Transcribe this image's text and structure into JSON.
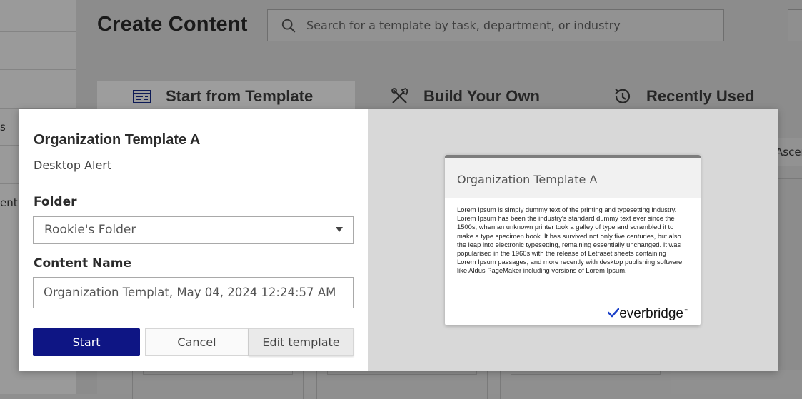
{
  "background": {
    "page_title": "Create Content",
    "search": {
      "placeholder": "Search for a template by task, department, or industry"
    },
    "tabs": [
      {
        "label": "Start from Template",
        "icon": "template-icon",
        "active": true
      },
      {
        "label": "Build Your Own",
        "icon": "tools-icon",
        "active": false
      },
      {
        "label": "Recently Used",
        "icon": "history-icon",
        "active": false
      }
    ],
    "sidebar_fragments": [
      "s",
      "ent"
    ],
    "sort_fragment": "Ascen"
  },
  "modal": {
    "title": "Organization Template A",
    "subtitle": "Desktop Alert",
    "folder_label": "Folder",
    "folder_value": "Rookie's Folder",
    "content_name_label": "Content Name",
    "content_name_value": "Organization Templat, May 04, 2024 12:24:57 AM",
    "buttons": {
      "start": "Start",
      "cancel": "Cancel",
      "edit": "Edit template"
    },
    "preview": {
      "title": "Organization Template A",
      "body": "Lorem Ipsum is simply dummy text of the printing and typesetting industry. Lorem Ipsum has been the industry's standard dummy text ever since the 1500s, when an unknown printer took a galley of type and scrambled it to make a type specimen book. It has survived not only five centuries, but also the leap into electronic typesetting, remaining essentially unchanged. It was popularised in the 1960s with the release of Letraset sheets containing Lorem Ipsum passages, and more recently with desktop publishing software like Aldus PageMaker including versions of Lorem Ipsum.",
      "brand": "everbridge",
      "brand_mark": "™"
    }
  },
  "colors": {
    "primary_button": "#0e1584",
    "overlay": "#8f8f8f",
    "preview_panel": "#d8d8d8"
  }
}
